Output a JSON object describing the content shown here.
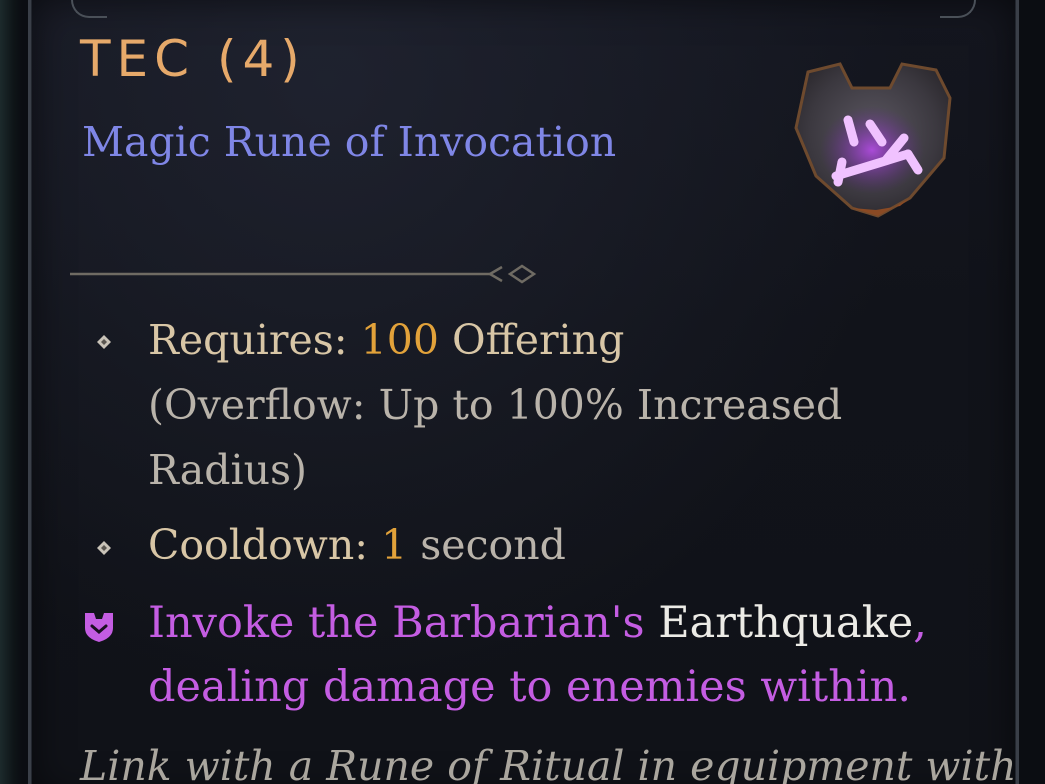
{
  "item": {
    "name": "TEC (4)",
    "type": "Magic Rune of Invocation",
    "rune_icon": "rune-shard-icon"
  },
  "properties": {
    "requires_label": "Requires: ",
    "requires_value": "100",
    "requires_unit": " Offering",
    "overflow_line1": "(Overflow: Up to 100% Increased",
    "overflow_line2": "Radius)",
    "cooldown_label": "Cooldown: ",
    "cooldown_value": "1",
    "cooldown_unit": " second"
  },
  "effect": {
    "part1": "Invoke the Barbarian's ",
    "skill": "Earthquake",
    "part2": ",",
    "line2": "dealing damage to enemies within."
  },
  "flavor": {
    "text": "Link with a Rune of Ritual in equipment with"
  },
  "colors": {
    "title": "#e6a96a",
    "subtitle": "#7f86e6",
    "number": "#e2a23a",
    "magic": "#c45de2"
  }
}
